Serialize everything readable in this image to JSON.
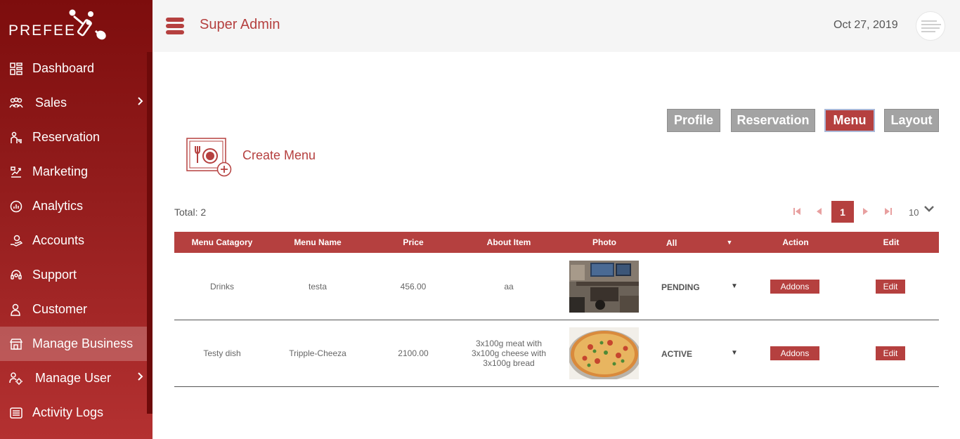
{
  "brand": {
    "name": "PREFEE"
  },
  "sidebar": {
    "items": [
      {
        "label": "Dashboard",
        "icon": "dashboard-icon"
      },
      {
        "label": "Sales",
        "icon": "people-group-icon",
        "has_submenu": true
      },
      {
        "label": "Reservation",
        "icon": "reservation-icon"
      },
      {
        "label": "Marketing",
        "icon": "marketing-icon"
      },
      {
        "label": "Analytics",
        "icon": "analytics-gauge-icon"
      },
      {
        "label": "Accounts",
        "icon": "accounts-coin-hand-icon"
      },
      {
        "label": "Support",
        "icon": "support-headset-icon"
      },
      {
        "label": "Customer",
        "icon": "customer-user-icon"
      },
      {
        "label": "Manage Business",
        "icon": "store-icon",
        "active": true
      },
      {
        "label": "Manage User",
        "icon": "users-gear-icon",
        "has_submenu": true
      },
      {
        "label": "Activity Logs",
        "icon": "logs-list-icon"
      }
    ]
  },
  "header": {
    "title": "Super Admin",
    "date": "Oct 27, 2019"
  },
  "tabs": [
    {
      "label": "Profile"
    },
    {
      "label": "Reservation"
    },
    {
      "label": "Menu",
      "active": true
    },
    {
      "label": "Layout"
    }
  ],
  "create": {
    "label": "Create Menu"
  },
  "total": {
    "label": "Total: 2"
  },
  "pagination": {
    "current": "1",
    "page_size": "10"
  },
  "table": {
    "columns": [
      "Menu Catagory",
      "Menu Name",
      "Price",
      "About Item",
      "Photo",
      "All",
      "Action",
      "Edit"
    ],
    "rows": [
      {
        "category": "Drinks",
        "name": "testa",
        "price": "456.00",
        "about": "aa",
        "status": "PENDING",
        "action": "Addons",
        "edit": "Edit"
      },
      {
        "category": "Testy dish",
        "name": "Tripple-Cheeza",
        "price": "2100.00",
        "about_lines": [
          "3x100g meat with",
          "3x100g cheese with",
          "3x100g bread"
        ],
        "status": "ACTIVE",
        "action": "Addons",
        "edit": "Edit"
      }
    ]
  },
  "colors": {
    "accent": "#b5403f",
    "sidebar_top": "#7d0d0d",
    "tab_inactive": "#a3a3a3"
  }
}
